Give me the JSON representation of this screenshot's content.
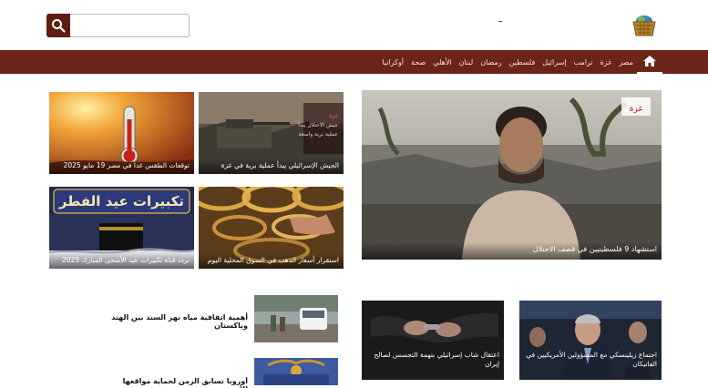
{
  "header": {
    "logo_icon": "basket-logo-icon",
    "dash": "-",
    "search": {
      "placeholder": "",
      "value": "",
      "button_icon": "search-icon"
    }
  },
  "nav": {
    "home_icon": "home-icon",
    "items": [
      "مصر",
      "غزة",
      "ترامب",
      "إسرائيل",
      "فلسطين",
      "رمضان",
      "لبنان",
      "الأهلي",
      "صحة",
      "أوكرانيا"
    ]
  },
  "hero": {
    "caption": "استشهاد 9 فلسطينيين في قصف الاحتلال",
    "overlay_text": "غزة",
    "brand_color": "#6b2417"
  },
  "grid": [
    {
      "caption": "الجيش الإسرائيلي يبدأ عملية برية في غزة",
      "overlay_lines": [
        "غزة",
        "جيش الاحتلال يبدأ",
        "عملية برية واسعة"
      ]
    },
    {
      "caption": "توقعات الطقس غدا في مصر 19 مايو 2025"
    },
    {
      "caption": "استقرار أسعار الذهب في السوق المحلية اليوم"
    },
    {
      "caption": "تردد قناة تكبيرات عيد الأضحى المبارك 2025",
      "banner_text": "تكبيرات عيد الفطر"
    }
  ],
  "bottom_cards": [
    {
      "caption": "اجتماع زيلينسكي مع المسؤولين الأمريكيين في الفاتيكان"
    },
    {
      "caption": "اعتقال شاب إسرائيلي بتهمة التجسس لصالح إيران"
    }
  ],
  "side_list": [
    {
      "title": "أهمية اتفاقية مياه نهر السند بين الهند وباكستان"
    },
    {
      "title": "أوروبا تسابق الزمن لحماية مواقعها الأثرية"
    }
  ]
}
